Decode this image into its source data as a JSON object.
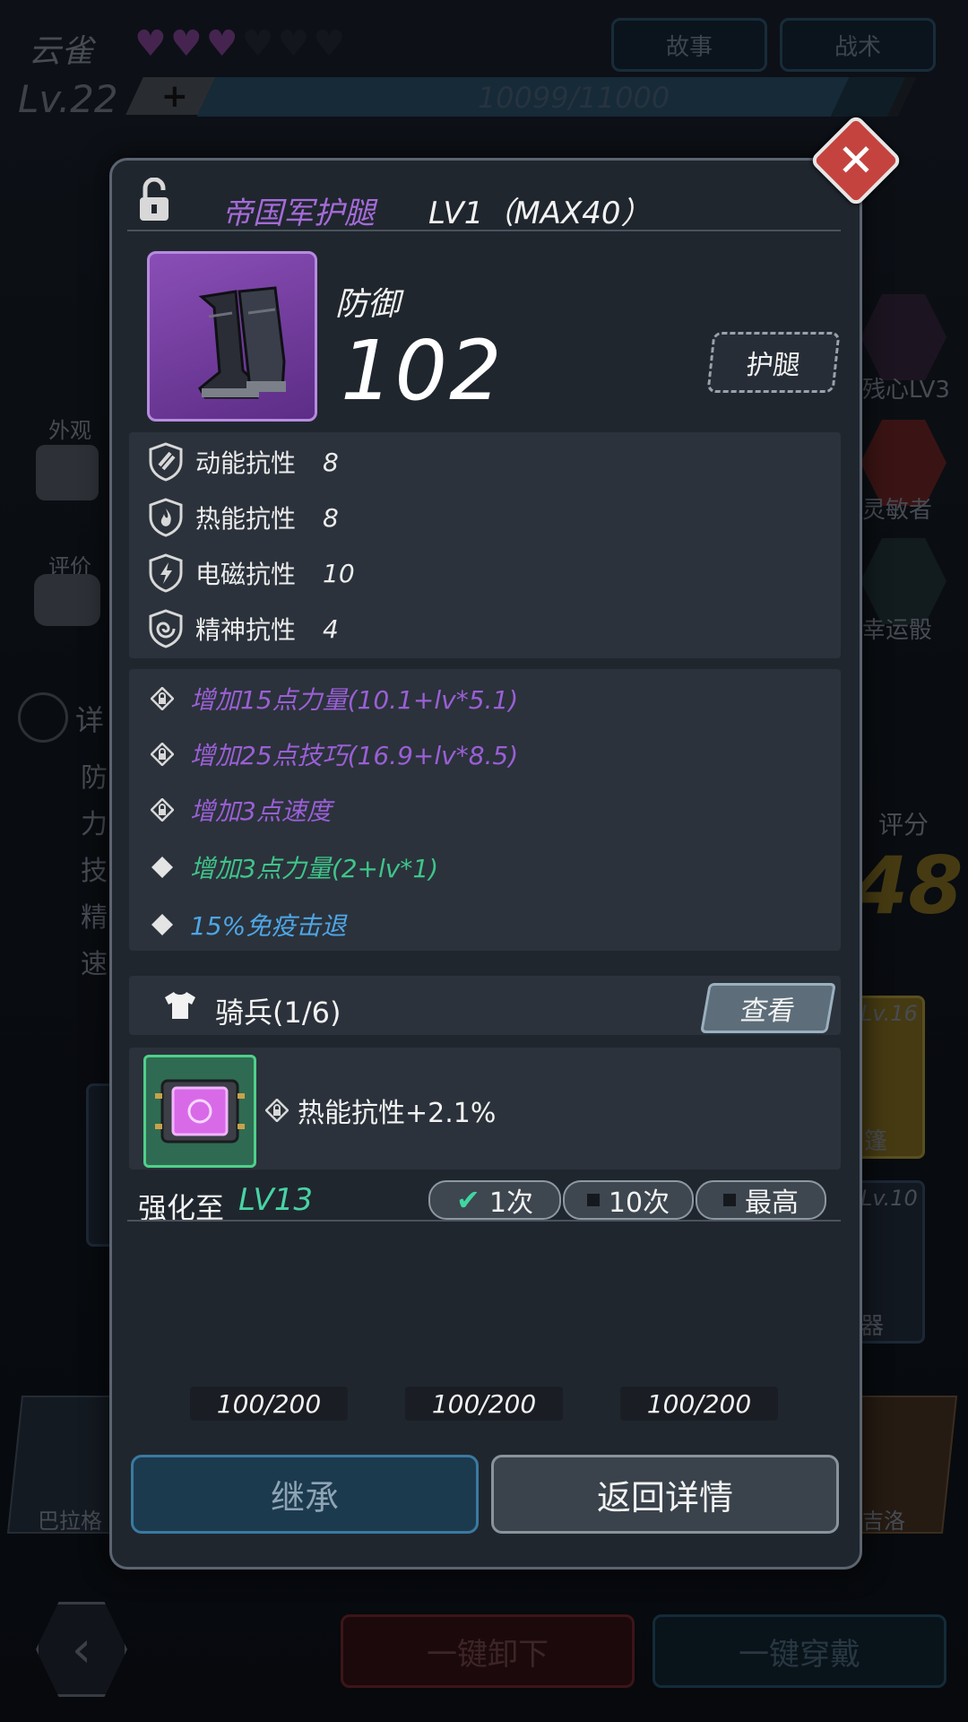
{
  "background": {
    "character_name": "云雀",
    "hearts_filled": 3,
    "hearts_total": 6,
    "top_buttons": [
      "故事",
      "战术"
    ],
    "level": "Lv.22",
    "plus": "+",
    "xp_text": "10099/11000",
    "xp_progress": 0.918,
    "left_labels": [
      "外观",
      "评价"
    ],
    "detail_section": {
      "title": "详",
      "rows": [
        "防",
        "力",
        "技",
        "精",
        "速"
      ]
    },
    "right_labels": [
      "残心LV3",
      "灵敏者",
      "幸运骰"
    ],
    "score_label": "评分",
    "score_partial": "48",
    "equip_cards": [
      {
        "level": "Lv.16",
        "name": "篷"
      },
      {
        "level": "Lv.10",
        "name": "器"
      }
    ],
    "bottom_characters": [
      "巴拉格",
      "吉洛"
    ],
    "bottom_buttons": [
      "一键卸下",
      "一键穿戴"
    ],
    "back_icon": "chevron-left-icon"
  },
  "dialog": {
    "item_name": "帝国军护腿",
    "item_level": "LV1（MAX40）",
    "stat_label": "防御",
    "stat_value": "102",
    "slot_tag": "护腿",
    "resistances": [
      {
        "icon": "kinetic-icon",
        "name": "动能抗性",
        "value": "8"
      },
      {
        "icon": "thermal-icon",
        "name": "热能抗性",
        "value": "8"
      },
      {
        "icon": "electromagnetic-icon",
        "name": "电磁抗性",
        "value": "10"
      },
      {
        "icon": "psychic-icon",
        "name": "精神抗性",
        "value": "4"
      }
    ],
    "attributes": [
      {
        "text": "增加15点力量(10.1+lv*5.1)",
        "color": "#9a5fd6",
        "icon": "locked-diamond-icon"
      },
      {
        "text": "增加25点技巧(16.9+lv*8.5)",
        "color": "#9a5fd6",
        "icon": "locked-diamond-icon"
      },
      {
        "text": "增加3点速度",
        "color": "#9a5fd6",
        "icon": "locked-diamond-icon"
      },
      {
        "text": "增加3点力量(2+lv*1)",
        "color": "#3fc48a",
        "icon": "diamond-icon"
      },
      {
        "text": "15%免疫击退",
        "color": "#4ea6e6",
        "icon": "diamond-icon"
      }
    ],
    "set": {
      "name": "骑兵(1/6)",
      "view_button": "查看"
    },
    "chip_bonus": "热能抗性+2.1%",
    "enhance": {
      "label": "强化至",
      "target": "LV13",
      "options": [
        {
          "label": "1次",
          "selected": true
        },
        {
          "label": "10次",
          "selected": false
        },
        {
          "label": "最高",
          "selected": false
        }
      ]
    },
    "materials": [
      "100/200",
      "100/200",
      "100/200"
    ],
    "inherit_button": "继承",
    "return_button": "返回详情"
  },
  "colors": {
    "rarity_purple": "#a46bd8",
    "close_red": "#c5433f",
    "enhance_teal": "#49d3a4"
  }
}
